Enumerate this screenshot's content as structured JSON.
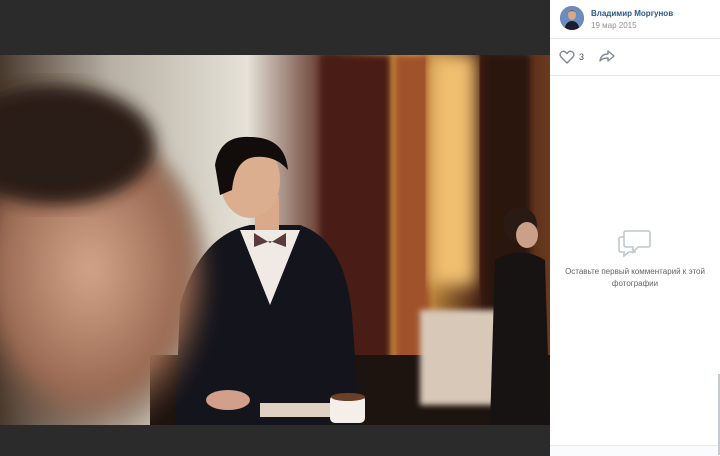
{
  "author": {
    "name": "Владимир Моргунов",
    "date": "19 мар 2015"
  },
  "actions": {
    "likes": "3",
    "like_icon": "heart-icon",
    "share_icon": "share-icon"
  },
  "comments": {
    "empty_text": "Оставьте первый комментарий к этой фотографии",
    "icon": "speech-bubbles-icon"
  },
  "colors": {
    "link": "#2a5885",
    "muted": "#939393",
    "viewer_bg": "#2b2b2b"
  }
}
